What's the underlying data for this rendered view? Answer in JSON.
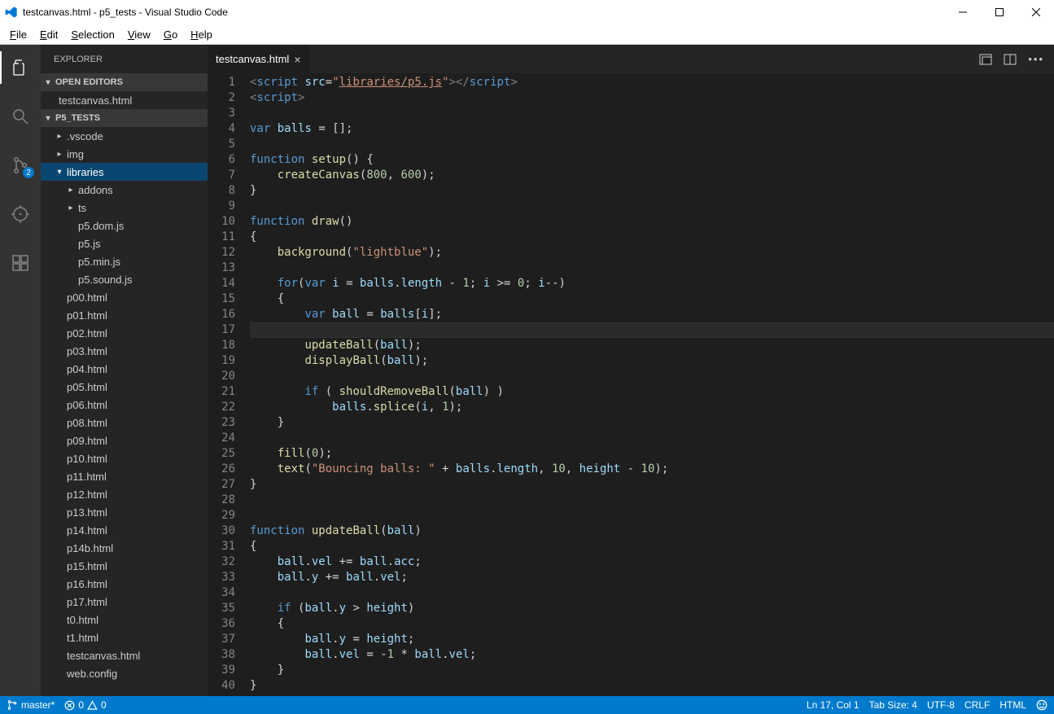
{
  "window": {
    "title": "testcanvas.html - p5_tests - Visual Studio Code"
  },
  "menu": [
    "File",
    "Edit",
    "Selection",
    "View",
    "Go",
    "Help"
  ],
  "activitybar": {
    "scm_badge": "2"
  },
  "sidebar": {
    "title": "EXPLORER",
    "sections": {
      "open_editors": "Open Editors",
      "project": "P5_TESTS"
    },
    "open_editor_items": [
      "testcanvas.html"
    ],
    "tree": [
      {
        "label": ".vscode",
        "indent": 1,
        "kind": "folder-closed"
      },
      {
        "label": "img",
        "indent": 1,
        "kind": "folder-closed"
      },
      {
        "label": "libraries",
        "indent": 1,
        "kind": "folder-open",
        "selected": true
      },
      {
        "label": "addons",
        "indent": 2,
        "kind": "folder-closed"
      },
      {
        "label": "ts",
        "indent": 2,
        "kind": "folder-closed"
      },
      {
        "label": "p5.dom.js",
        "indent": 2,
        "kind": "file"
      },
      {
        "label": "p5.js",
        "indent": 2,
        "kind": "file"
      },
      {
        "label": "p5.min.js",
        "indent": 2,
        "kind": "file"
      },
      {
        "label": "p5.sound.js",
        "indent": 2,
        "kind": "file"
      },
      {
        "label": "p00.html",
        "indent": 1,
        "kind": "file"
      },
      {
        "label": "p01.html",
        "indent": 1,
        "kind": "file"
      },
      {
        "label": "p02.html",
        "indent": 1,
        "kind": "file"
      },
      {
        "label": "p03.html",
        "indent": 1,
        "kind": "file"
      },
      {
        "label": "p04.html",
        "indent": 1,
        "kind": "file"
      },
      {
        "label": "p05.html",
        "indent": 1,
        "kind": "file"
      },
      {
        "label": "p06.html",
        "indent": 1,
        "kind": "file"
      },
      {
        "label": "p08.html",
        "indent": 1,
        "kind": "file"
      },
      {
        "label": "p09.html",
        "indent": 1,
        "kind": "file"
      },
      {
        "label": "p10.html",
        "indent": 1,
        "kind": "file"
      },
      {
        "label": "p11.html",
        "indent": 1,
        "kind": "file"
      },
      {
        "label": "p12.html",
        "indent": 1,
        "kind": "file"
      },
      {
        "label": "p13.html",
        "indent": 1,
        "kind": "file"
      },
      {
        "label": "p14.html",
        "indent": 1,
        "kind": "file"
      },
      {
        "label": "p14b.html",
        "indent": 1,
        "kind": "file"
      },
      {
        "label": "p15.html",
        "indent": 1,
        "kind": "file"
      },
      {
        "label": "p16.html",
        "indent": 1,
        "kind": "file"
      },
      {
        "label": "p17.html",
        "indent": 1,
        "kind": "file"
      },
      {
        "label": "t0.html",
        "indent": 1,
        "kind": "file"
      },
      {
        "label": "t1.html",
        "indent": 1,
        "kind": "file"
      },
      {
        "label": "testcanvas.html",
        "indent": 1,
        "kind": "file"
      },
      {
        "label": "web.config",
        "indent": 1,
        "kind": "file"
      }
    ]
  },
  "tabs": [
    {
      "label": "testcanvas.html"
    }
  ],
  "editor": {
    "first_line": 1,
    "current_line": 17,
    "lines": [
      {
        "n": 1,
        "html": "<span class='t-punc'>&lt;</span><span class='t-tag'>script</span> <span class='t-attr'>src</span><span class='t-op'>=</span><span class='t-str'>\"</span><span class='t-link'>libraries/p5.js</span><span class='t-str'>\"</span><span class='t-punc'>&gt;&lt;/</span><span class='t-tag'>script</span><span class='t-punc'>&gt;</span>"
      },
      {
        "n": 2,
        "html": "<span class='t-punc'>&lt;</span><span class='t-tag'>script</span><span class='t-punc'>&gt;</span>"
      },
      {
        "n": 3,
        "html": ""
      },
      {
        "n": 4,
        "html": "<span class='t-kw'>var</span> <span class='t-var'>balls</span> <span class='t-op'>=</span> [];"
      },
      {
        "n": 5,
        "html": ""
      },
      {
        "n": 6,
        "html": "<span class='t-kw'>function</span> <span class='t-fn'>setup</span>() {"
      },
      {
        "n": 7,
        "html": "    <span class='t-fn'>createCanvas</span>(<span class='t-num'>800</span>, <span class='t-num'>600</span>);"
      },
      {
        "n": 8,
        "html": "}"
      },
      {
        "n": 9,
        "html": ""
      },
      {
        "n": 10,
        "html": "<span class='t-kw'>function</span> <span class='t-fn'>draw</span>()"
      },
      {
        "n": 11,
        "html": "{"
      },
      {
        "n": 12,
        "html": "    <span class='t-fn'>background</span>(<span class='t-str'>\"lightblue\"</span>);"
      },
      {
        "n": 13,
        "html": ""
      },
      {
        "n": 14,
        "html": "    <span class='t-kw'>for</span>(<span class='t-kw'>var</span> <span class='t-var'>i</span> <span class='t-op'>=</span> <span class='t-var'>balls</span>.<span class='t-var'>length</span> <span class='t-op'>-</span> <span class='t-num'>1</span>; <span class='t-var'>i</span> <span class='t-op'>&gt;=</span> <span class='t-num'>0</span>; <span class='t-var'>i</span><span class='t-op'>--</span>)"
      },
      {
        "n": 15,
        "html": "    {"
      },
      {
        "n": 16,
        "html": "        <span class='t-kw'>var</span> <span class='t-var'>ball</span> <span class='t-op'>=</span> <span class='t-var'>balls</span>[<span class='t-var'>i</span>];"
      },
      {
        "n": 17,
        "html": ""
      },
      {
        "n": 18,
        "html": "        <span class='t-fn'>updateBall</span>(<span class='t-var'>ball</span>);"
      },
      {
        "n": 19,
        "html": "        <span class='t-fn'>displayBall</span>(<span class='t-var'>ball</span>);"
      },
      {
        "n": 20,
        "html": ""
      },
      {
        "n": 21,
        "html": "        <span class='t-kw'>if</span> ( <span class='t-fn'>shouldRemoveBall</span>(<span class='t-var'>ball</span>) )"
      },
      {
        "n": 22,
        "html": "            <span class='t-var'>balls</span>.<span class='t-fn'>splice</span>(<span class='t-var'>i</span>, <span class='t-num'>1</span>);"
      },
      {
        "n": 23,
        "html": "    }"
      },
      {
        "n": 24,
        "html": ""
      },
      {
        "n": 25,
        "html": "    <span class='t-fn'>fill</span>(<span class='t-num'>0</span>);"
      },
      {
        "n": 26,
        "html": "    <span class='t-fn'>text</span>(<span class='t-str'>\"Bouncing balls: \"</span> <span class='t-op'>+</span> <span class='t-var'>balls</span>.<span class='t-var'>length</span>, <span class='t-num'>10</span>, <span class='t-var'>height</span> <span class='t-op'>-</span> <span class='t-num'>10</span>);"
      },
      {
        "n": 27,
        "html": "}"
      },
      {
        "n": 28,
        "html": ""
      },
      {
        "n": 29,
        "html": ""
      },
      {
        "n": 30,
        "html": "<span class='t-kw'>function</span> <span class='t-fn'>updateBall</span>(<span class='t-var'>ball</span>)"
      },
      {
        "n": 31,
        "html": "{"
      },
      {
        "n": 32,
        "html": "    <span class='t-var'>ball</span>.<span class='t-var'>vel</span> <span class='t-op'>+=</span> <span class='t-var'>ball</span>.<span class='t-var'>acc</span>;"
      },
      {
        "n": 33,
        "html": "    <span class='t-var'>ball</span>.<span class='t-var'>y</span> <span class='t-op'>+=</span> <span class='t-var'>ball</span>.<span class='t-var'>vel</span>;"
      },
      {
        "n": 34,
        "html": ""
      },
      {
        "n": 35,
        "html": "    <span class='t-kw'>if</span> (<span class='t-var'>ball</span>.<span class='t-var'>y</span> <span class='t-op'>&gt;</span> <span class='t-var'>height</span>)"
      },
      {
        "n": 36,
        "html": "    {"
      },
      {
        "n": 37,
        "html": "        <span class='t-var'>ball</span>.<span class='t-var'>y</span> <span class='t-op'>=</span> <span class='t-var'>height</span>;"
      },
      {
        "n": 38,
        "html": "        <span class='t-var'>ball</span>.<span class='t-var'>vel</span> <span class='t-op'>=</span> <span class='t-op'>-</span><span class='t-num'>1</span> <span class='t-op'>*</span> <span class='t-var'>ball</span>.<span class='t-var'>vel</span>;"
      },
      {
        "n": 39,
        "html": "    }"
      },
      {
        "n": 40,
        "html": "}"
      }
    ]
  },
  "statusbar": {
    "branch": "master*",
    "errors": "0",
    "warnings": "0",
    "position": "Ln 17, Col 1",
    "tabsize": "Tab Size: 4",
    "encoding": "UTF-8",
    "eol": "CRLF",
    "lang": "HTML"
  }
}
